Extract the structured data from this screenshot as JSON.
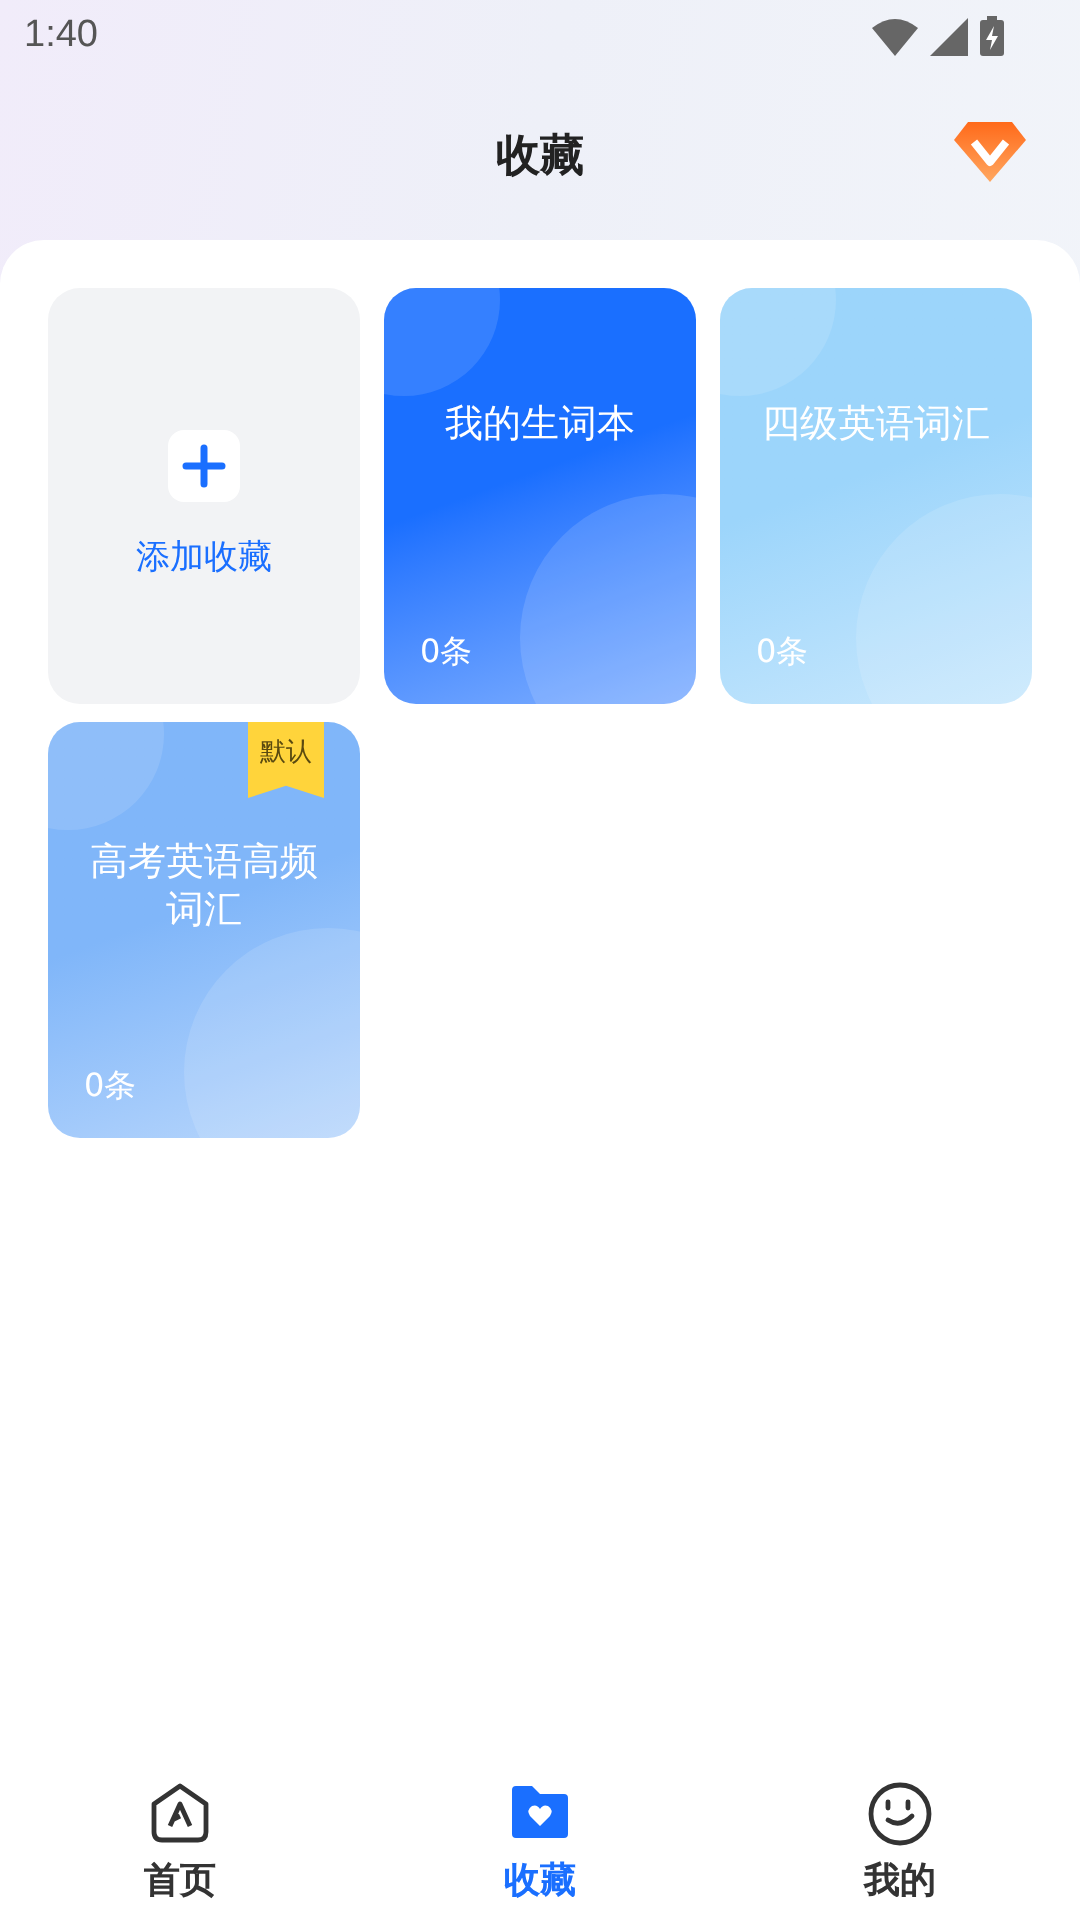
{
  "status_bar": {
    "time": "1:40"
  },
  "header": {
    "title": "收藏"
  },
  "collections": [
    {
      "kind": "add",
      "label": "添加收藏"
    },
    {
      "kind": "book",
      "title": "我的生词本",
      "count": "0条",
      "color": "#1a6fff"
    },
    {
      "kind": "book",
      "title": "四级英语词汇",
      "count": "0条",
      "color": "#9cd5fb"
    },
    {
      "kind": "book",
      "title": "高考英语高频词汇",
      "count": "0条",
      "color": "#80b6f9",
      "badge": "默认"
    }
  ],
  "bottom_nav": [
    {
      "kind": "home",
      "label": "首页",
      "selected": false
    },
    {
      "kind": "collection",
      "label": "收藏",
      "selected": true
    },
    {
      "kind": "profile",
      "label": "我的",
      "selected": false
    }
  ]
}
